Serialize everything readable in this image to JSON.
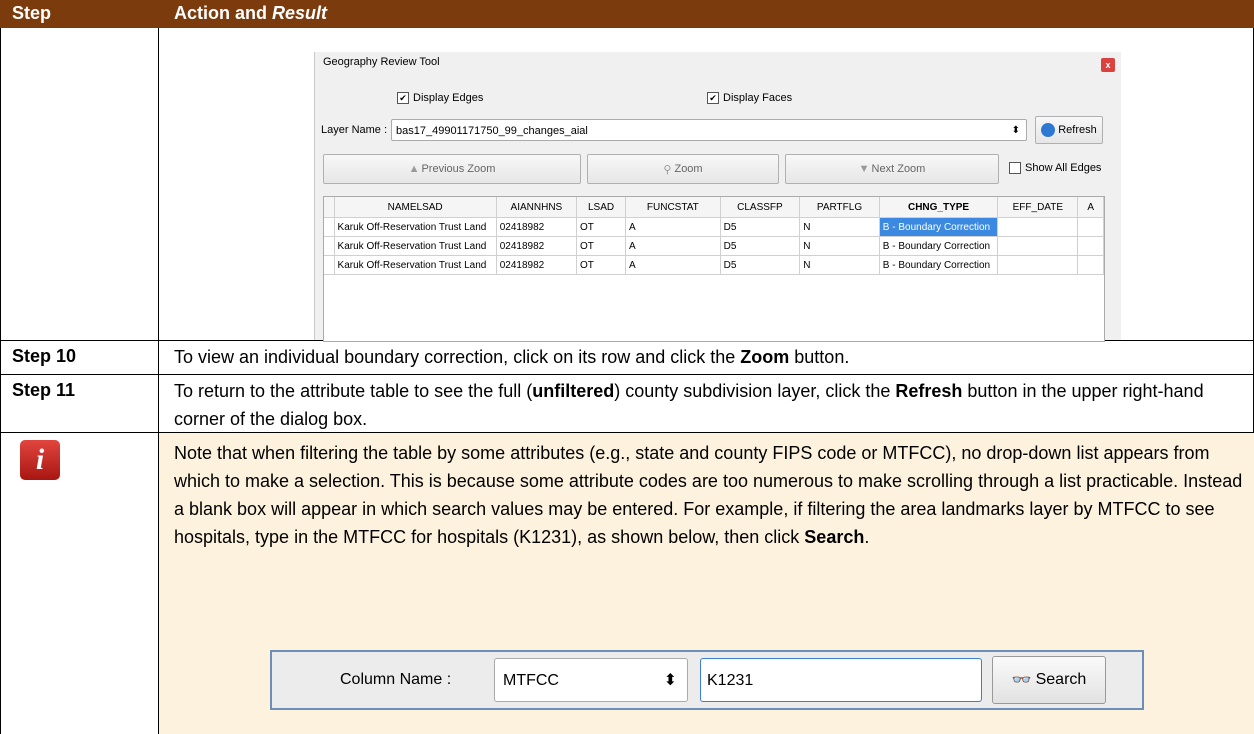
{
  "header": {
    "col1": "Step",
    "col2_prefix": "Action and ",
    "col2_italic": "Result"
  },
  "dialog": {
    "title": "Geography Review Tool",
    "close": "x",
    "display_edges": "Display Edges",
    "display_faces": "Display Faces",
    "layer_label": "Layer Name :",
    "layer_value": "bas17_49901171750_99_changes_aial",
    "refresh": "Refresh",
    "prev_zoom": "Previous Zoom",
    "zoom": "Zoom",
    "next_zoom": "Next Zoom",
    "show_all_edges": "Show All Edges",
    "columns": [
      "NAMELSAD",
      "AIANNHNS",
      "LSAD",
      "FUNCSTAT",
      "CLASSFP",
      "PARTFLG",
      "CHNG_TYPE",
      "EFF_DATE",
      "A"
    ],
    "rows": [
      [
        "Karuk Off-Reservation Trust Land",
        "02418982",
        "OT",
        "A",
        "D5",
        "N",
        "B - Boundary Correction",
        ""
      ],
      [
        "Karuk Off-Reservation Trust Land",
        "02418982",
        "OT",
        "A",
        "D5",
        "N",
        "B - Boundary Correction",
        ""
      ],
      [
        "Karuk Off-Reservation Trust Land",
        "02418982",
        "OT",
        "A",
        "D5",
        "N",
        "B - Boundary Correction",
        ""
      ]
    ]
  },
  "step10": {
    "label": "Step 10",
    "t1": "To view an individual boundary correction, click on its row and click the ",
    "b1": "Zoom",
    "t2": " button."
  },
  "step11": {
    "label": "Step 11",
    "t1": "To return to the attribute table to see the full (",
    "b1": "unfiltered",
    "t2": ") county subdivision layer, click the ",
    "b2": "Refresh",
    "t3": " button in the upper right-hand corner of the dialog box."
  },
  "note": {
    "t1": "Note that when filtering the table by some attributes (e.g., state and county FIPS code or MTFCC), no drop-down list appears from which to make a selection. This is because some attribute codes are too numerous to make scrolling through a list practicable. Instead a blank box will appear in which search values may be entered. For example, if filtering the area landmarks layer by MTFCC to see hospitals, type in the MTFCC for hospitals (K1231), as shown below, then click ",
    "b1": "Search",
    "t2": "."
  },
  "search_bar": {
    "label": "Column Name :",
    "column_value": "MTFCC",
    "input_value": "K1231",
    "button": "Search"
  },
  "colors": {
    "header": "#7b3b0c",
    "note_bg": "#fdf2dd",
    "selected": "#3b89e0"
  }
}
